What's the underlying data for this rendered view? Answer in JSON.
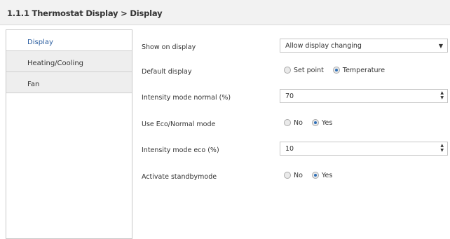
{
  "header": {
    "title": "1.1.1 Thermostat Display > Display"
  },
  "sidebar": {
    "items": [
      {
        "label": "Display"
      },
      {
        "label": "Heating/Cooling"
      },
      {
        "label": "Fan"
      }
    ]
  },
  "settings": {
    "show_on_display": {
      "label": "Show on display",
      "value": "Allow display changing"
    },
    "default_display": {
      "label": "Default display",
      "options": [
        "Set point",
        "Temperature"
      ],
      "selected": "Temperature"
    },
    "intensity_normal": {
      "label": "Intensity mode normal (%)",
      "value": "70"
    },
    "use_eco": {
      "label": "Use Eco/Normal mode",
      "options": [
        "No",
        "Yes"
      ],
      "selected": "Yes"
    },
    "intensity_eco": {
      "label": "Intensity mode eco (%)",
      "value": "10"
    },
    "standby": {
      "label": "Activate standbymode",
      "options": [
        "No",
        "Yes"
      ],
      "selected": "Yes"
    }
  },
  "colors": {
    "accent": "#2f6fb6",
    "active_text": "#2a5d9f",
    "header_bg": "#f2f2f2"
  }
}
